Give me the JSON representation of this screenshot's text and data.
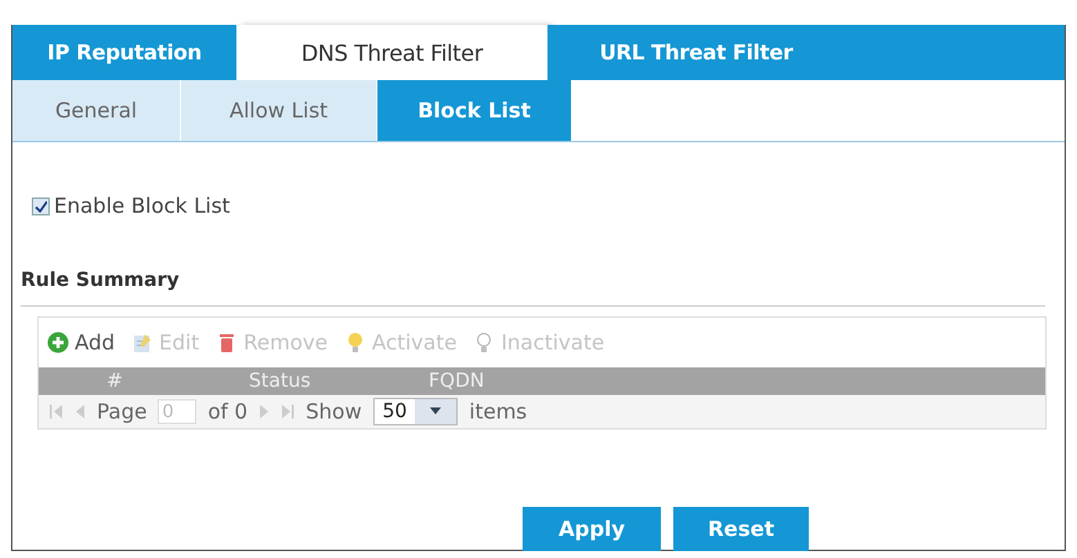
{
  "tabs": [
    {
      "label": "IP Reputation",
      "selected": false
    },
    {
      "label": "DNS Threat Filter",
      "selected": true
    },
    {
      "label": "URL Threat Filter",
      "selected": false
    }
  ],
  "sub_tabs": [
    {
      "label": "General",
      "selected": false
    },
    {
      "label": "Allow List",
      "selected": false
    },
    {
      "label": "Block List",
      "selected": true
    }
  ],
  "enable_block_list": {
    "label": "Enable Block List",
    "checked": true
  },
  "rule_summary": {
    "title": "Rule Summary",
    "toolbar": [
      {
        "kind": "add",
        "label": "Add",
        "disabled": false
      },
      {
        "kind": "edit",
        "label": "Edit",
        "disabled": true
      },
      {
        "kind": "remove",
        "label": "Remove",
        "disabled": true
      },
      {
        "kind": "activate",
        "label": "Activate",
        "disabled": true
      },
      {
        "kind": "inactivate",
        "label": "Inactivate",
        "disabled": true
      }
    ],
    "columns": [
      "#",
      "Status",
      "FQDN"
    ],
    "pager": {
      "page_label": "Page",
      "page_value": "0",
      "of_label": "of 0",
      "show_label": "Show",
      "show_value": "50",
      "items_label": "items"
    }
  },
  "buttons": [
    "Apply",
    "Reset"
  ]
}
